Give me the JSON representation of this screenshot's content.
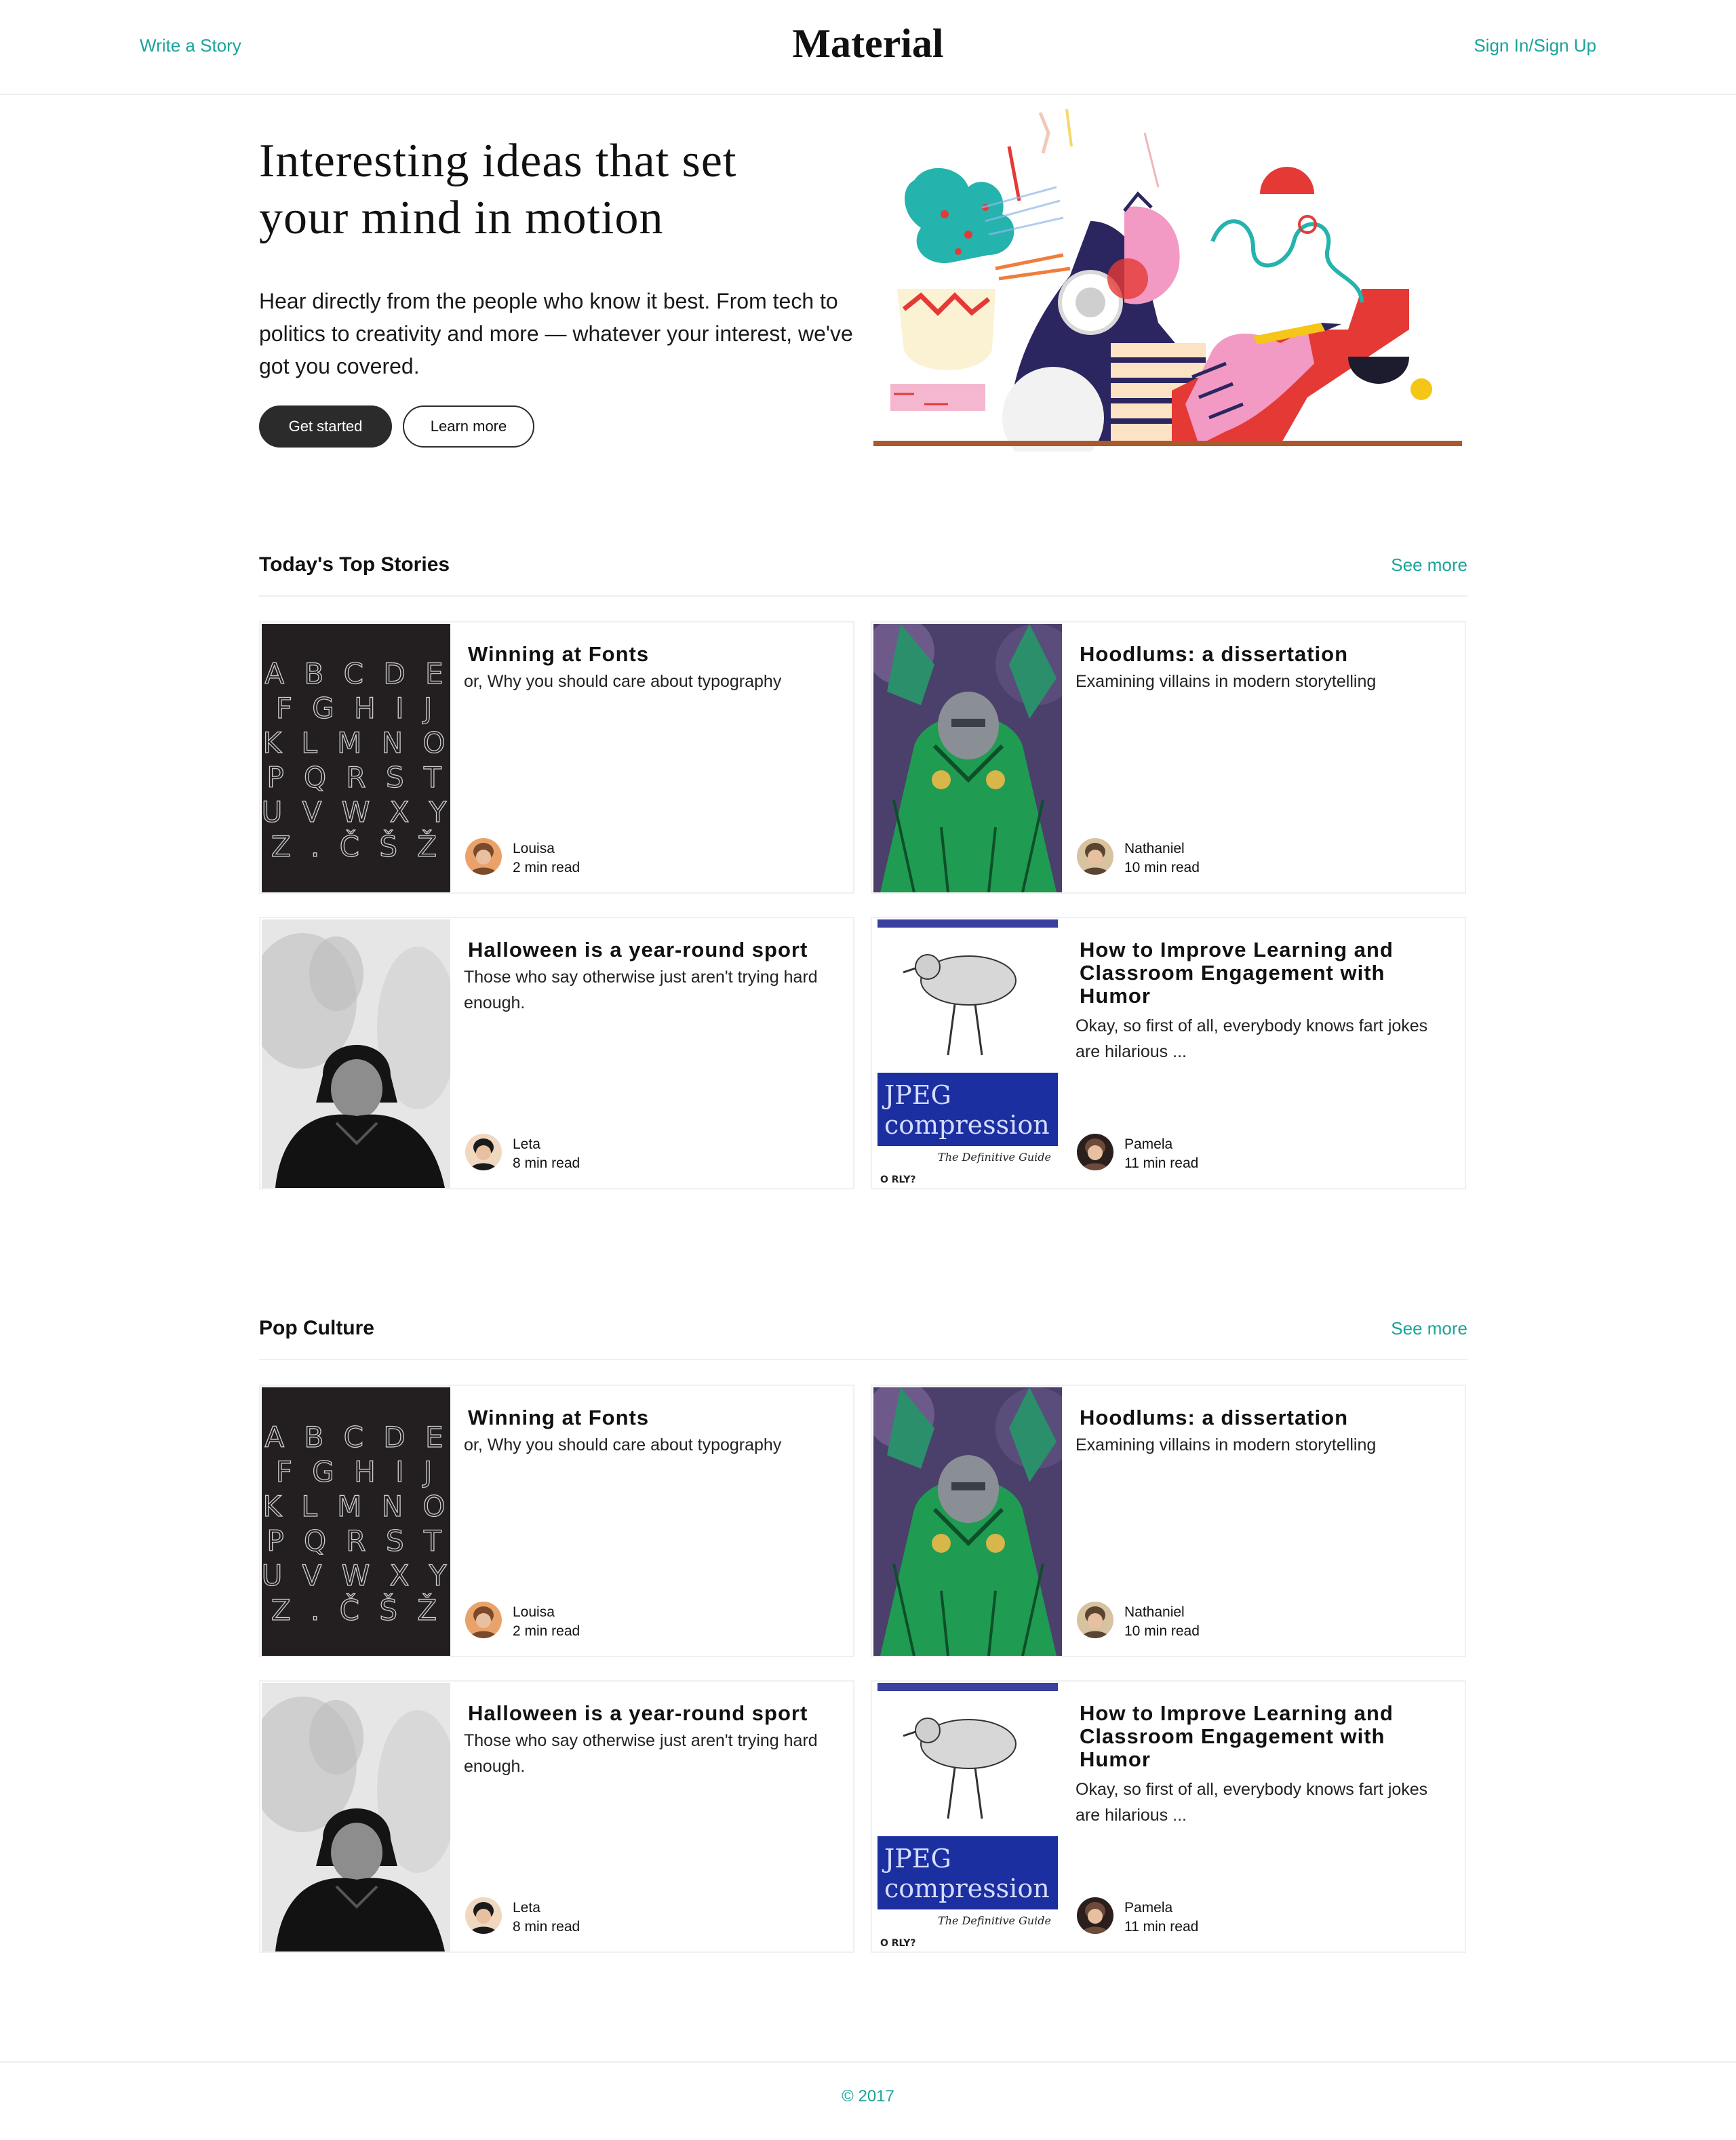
{
  "header": {
    "write_label": "Write a Story",
    "logo": "Material",
    "signin_label": "Sign In/Sign Up"
  },
  "hero": {
    "title_line1": "Interesting ideas that set",
    "title_line2": "your mind in motion",
    "subtitle_line1": "Hear directly from the people who know it best. From tech to",
    "subtitle_line2": "politics to creativity and more — whatever your interest, we've",
    "subtitle_line3": "got you covered.",
    "primary_button": "Get started",
    "secondary_button": "Learn more"
  },
  "sections": [
    {
      "title": "Today's Top Stories",
      "see_more": "See more",
      "cards": [
        {
          "title": "Winning at Fonts",
          "desc": "or, Why you should care about typography",
          "author": "Louisa",
          "read": "2 min read",
          "thumb": "fonts-alphabet-image"
        },
        {
          "title": "Hoodlums: a dissertation",
          "desc": "Examining villains in modern storytelling",
          "author": "Nathaniel",
          "read": "10 min read",
          "thumb": "comic-villain-image"
        },
        {
          "title": "Halloween is a year-round sport",
          "desc": "Those who say otherwise just aren't trying hard enough.",
          "author": "Leta",
          "read": "8 min read",
          "thumb": "ghost-photo-image"
        },
        {
          "title": "How to Improve Learning and Classroom Engagement with Humor",
          "desc": "Okay, so first of all, everybody knows fart jokes are hilarious ...",
          "author": "Pamela",
          "read": "11 min read",
          "thumb": "jpeg-book-cover-image"
        }
      ]
    },
    {
      "title": "Pop Culture",
      "see_more": "See more",
      "cards": [
        {
          "title": "Winning at Fonts",
          "desc": "or, Why you should care about typography",
          "author": "Louisa",
          "read": "2 min read",
          "thumb": "fonts-alphabet-image"
        },
        {
          "title": "Hoodlums: a dissertation",
          "desc": "Examining villains in modern storytelling",
          "author": "Nathaniel",
          "read": "10 min read",
          "thumb": "comic-villain-image"
        },
        {
          "title": "Halloween is a year-round sport",
          "desc": "Those who say otherwise just aren't trying hard enough.",
          "author": "Leta",
          "read": "8 min read",
          "thumb": "ghost-photo-image"
        },
        {
          "title": "How to Improve Learning and Classroom Engagement with Humor",
          "desc": "Okay, so first of all, everybody knows fart jokes are hilarious ...",
          "author": "Pamela",
          "read": "11 min read",
          "thumb": "jpeg-book-cover-image"
        }
      ]
    }
  ],
  "thumb_text": {
    "alphabet_rows": [
      "ABCDE",
      "FGHIJ",
      "KLMNO",
      "PQRST",
      "UVWXY",
      "Z.ČŠŽ"
    ],
    "book_title_1": "JPEG",
    "book_title_2": "compression",
    "book_subtitle": "The Definitive Guide",
    "book_publisher": "O RLY?"
  },
  "footer": {
    "copyright": "© 2017"
  },
  "colors": {
    "accent": "#1aa39a",
    "dark_button": "#2b2b2b"
  }
}
